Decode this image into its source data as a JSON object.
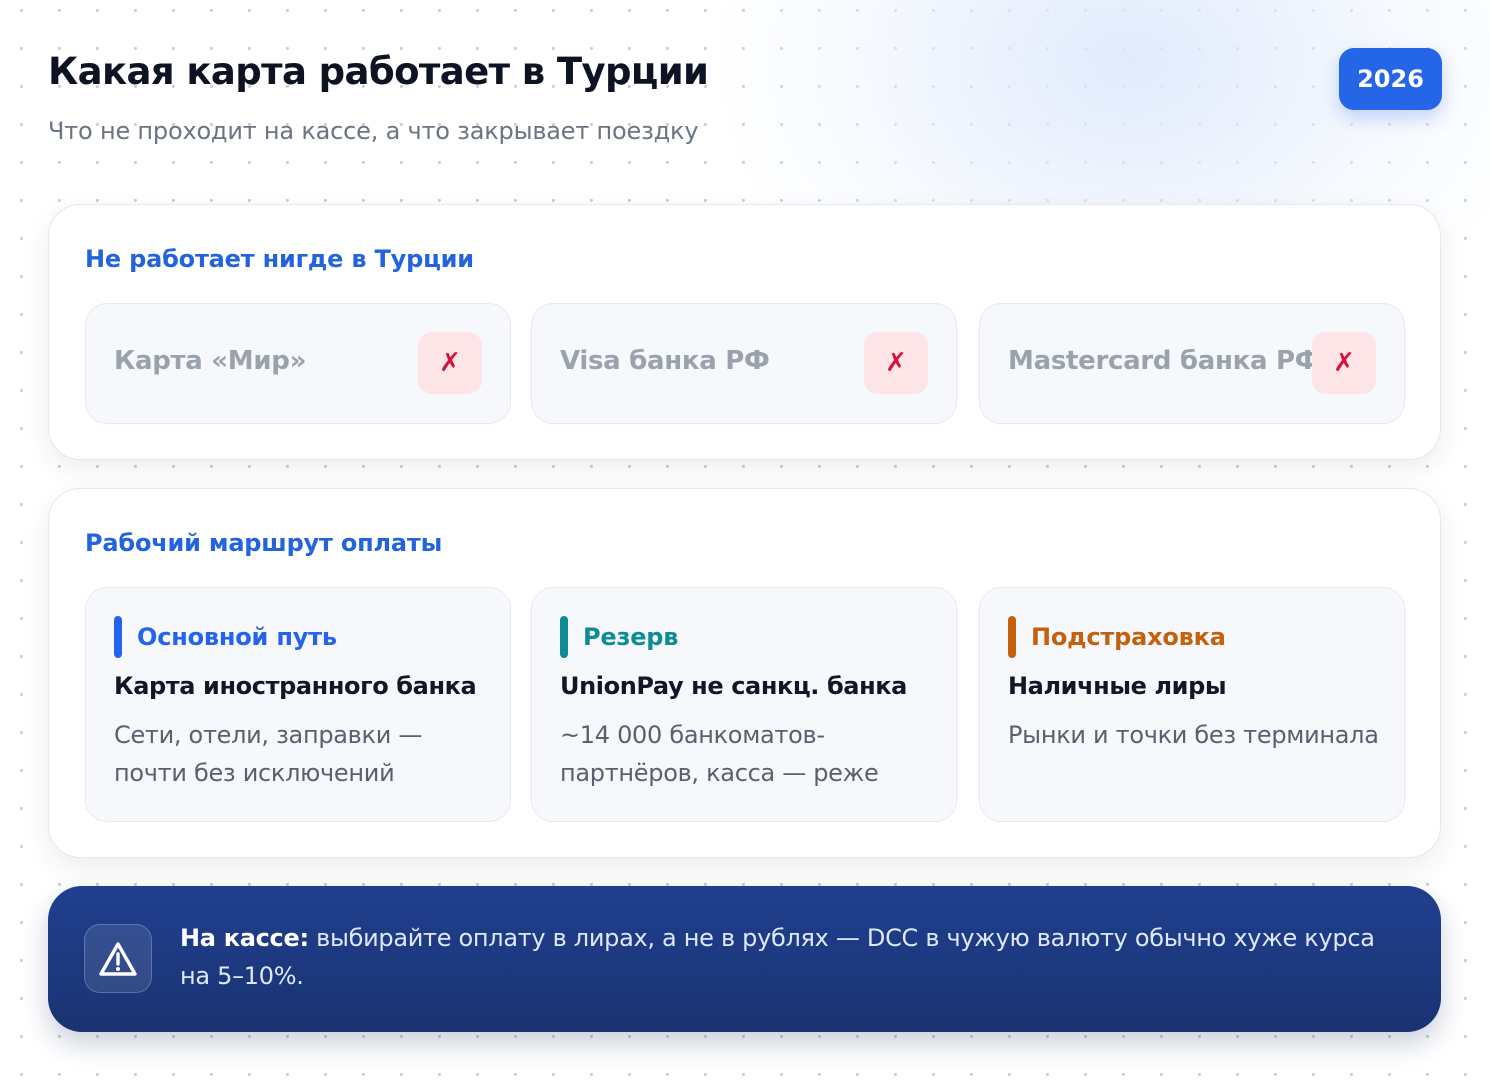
{
  "header": {
    "title": "Какая карта работает в Турции",
    "subtitle": "Что не проходит на кассе, а что закрывает поездку",
    "year": "2026"
  },
  "unavailable": {
    "title": "Не работает нигде в Турции",
    "cards": [
      {
        "label": "Карта «Мир»",
        "mark": "✗"
      },
      {
        "label": "Visa банка РФ",
        "mark": "✗"
      },
      {
        "label": "Mastercard банка РФ",
        "mark": "✗"
      }
    ]
  },
  "route": {
    "title": "Рабочий маршрут оплаты",
    "cards": [
      {
        "tag": "Основной путь",
        "heading": "Карта иностранного банка",
        "description": "Сети, отели, заправки — почти без исключений",
        "color": "#2563eb"
      },
      {
        "tag": "Резерв",
        "heading": "UnionPay не санкц. банка",
        "description": "~14 000 банкоматов-партнёров, касса — реже",
        "color": "#0e8c95"
      },
      {
        "tag": "Подстраховка",
        "heading": "Наличные лиры",
        "description": "Рынки и точки без терминала",
        "color": "#c4610f"
      }
    ]
  },
  "alert": {
    "icon": "warning-triangle-icon",
    "label": "На кассе:",
    "text": "выбирайте оплату в лирах, а не в рублях — DCC в чужую валюту обычно хуже курса на 5–10%."
  },
  "colors": {
    "accent": "#2565e8",
    "danger": "#d3123a",
    "alert_bg": "#1c3677"
  }
}
